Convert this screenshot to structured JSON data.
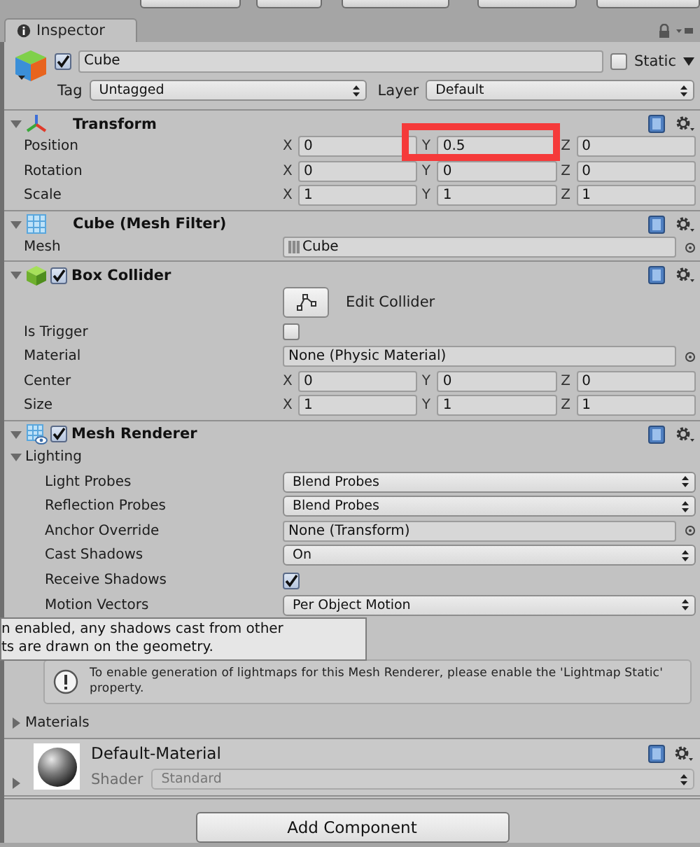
{
  "tab": {
    "label": "Inspector",
    "selected": true
  },
  "object": {
    "active": true,
    "name": "Cube",
    "static": false,
    "static_label": "Static",
    "tag_label": "Tag",
    "tag": "Untagged",
    "layer_label": "Layer",
    "layer": "Default"
  },
  "components": [
    {
      "kind": "transform",
      "title": "Transform",
      "expanded": true,
      "rows": [
        {
          "kind": "vector",
          "label": "Position",
          "values": [
            {
              "axis": "X",
              "value": "0",
              "highlighted": false
            },
            {
              "axis": "Y",
              "value": "0.5",
              "highlighted": true
            },
            {
              "axis": "Z",
              "value": "0",
              "highlighted": false
            }
          ]
        },
        {
          "kind": "vector",
          "label": "Rotation",
          "values": [
            {
              "axis": "X",
              "value": "0",
              "highlighted": false
            },
            {
              "axis": "Y",
              "value": "0",
              "highlighted": false
            },
            {
              "axis": "Z",
              "value": "0",
              "highlighted": false
            }
          ]
        },
        {
          "kind": "vector",
          "label": "Scale",
          "values": [
            {
              "axis": "X",
              "value": "1",
              "highlighted": false
            },
            {
              "axis": "Y",
              "value": "1",
              "highlighted": false
            },
            {
              "axis": "Z",
              "value": "1",
              "highlighted": false
            }
          ]
        }
      ]
    },
    {
      "kind": "mesh_filter",
      "title": "Cube (Mesh Filter)",
      "expanded": true,
      "rows": [
        {
          "kind": "mesh_object",
          "label": "Mesh",
          "value": "Cube"
        }
      ]
    },
    {
      "kind": "box_collider",
      "title": "Box Collider",
      "expanded": true,
      "enabled": true,
      "rows": [
        {
          "kind": "button",
          "label": "Edit Collider"
        },
        {
          "kind": "checkbox",
          "label": "Is Trigger",
          "checked": false
        },
        {
          "kind": "object",
          "label": "Material",
          "value": "None (Physic Material)"
        },
        {
          "kind": "vector",
          "label": "Center",
          "values": [
            {
              "axis": "X",
              "value": "0",
              "highlighted": false
            },
            {
              "axis": "Y",
              "value": "0",
              "highlighted": false
            },
            {
              "axis": "Z",
              "value": "0",
              "highlighted": false
            }
          ]
        },
        {
          "kind": "vector",
          "label": "Size",
          "values": [
            {
              "axis": "X",
              "value": "1",
              "highlighted": false
            },
            {
              "axis": "Y",
              "value": "1",
              "highlighted": false
            },
            {
              "axis": "Z",
              "value": "1",
              "highlighted": false
            }
          ]
        }
      ]
    },
    {
      "kind": "mesh_renderer",
      "title": "Mesh Renderer",
      "expanded": true,
      "enabled": true,
      "rows": [
        {
          "kind": "foldout",
          "label": "Lighting",
          "expanded": true,
          "children": [
            {
              "kind": "dropdown",
              "label": "Light Probes",
              "value": "Blend Probes"
            },
            {
              "kind": "dropdown",
              "label": "Reflection Probes",
              "value": "Blend Probes"
            },
            {
              "kind": "object",
              "label": "Anchor Override",
              "value": "None (Transform)"
            },
            {
              "kind": "dropdown",
              "label": "Cast Shadows",
              "value": "On"
            },
            {
              "kind": "checkbox",
              "label": "Receive Shadows",
              "checked": true
            },
            {
              "kind": "dropdown",
              "label": "Motion Vectors",
              "value": "Per Object Motion",
              "tooltip": [
                "n enabled, any shadows cast from other",
                "ts are drawn on the geometry."
              ]
            },
            {
              "kind": "info",
              "text": "To enable generation of lightmaps for this Mesh Renderer, please enable the 'Lightmap Static' property."
            }
          ]
        },
        {
          "kind": "foldout",
          "label": "Materials",
          "expanded": false
        }
      ]
    }
  ],
  "material": {
    "name": "Default-Material",
    "expanded": false,
    "shader_label": "Shader",
    "shader": "Standard",
    "shader_disabled": true
  },
  "add_component": "Add Component"
}
